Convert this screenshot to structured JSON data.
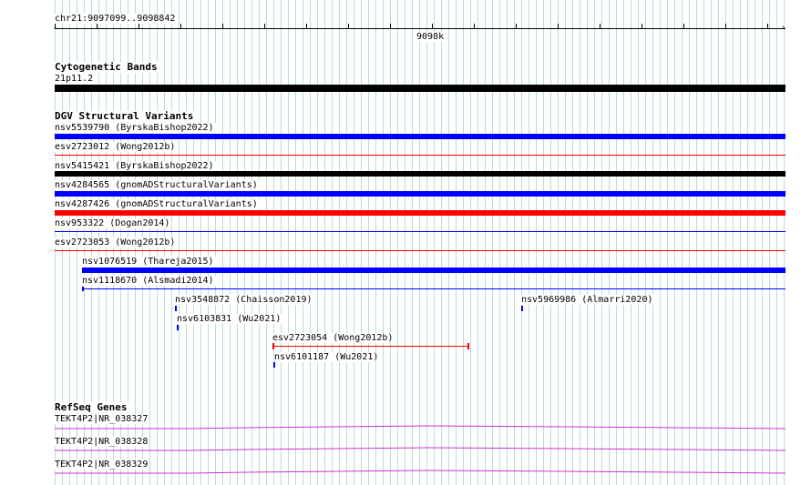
{
  "ruler": {
    "position_label": "chr21:9097099..9098842",
    "tick_label": "9098k"
  },
  "cytobands": {
    "title": "Cytogenetic Bands",
    "band_label": "21p11.2"
  },
  "dgv": {
    "title": "DGV Structural Variants",
    "items": [
      {
        "label": "nsv5539790 (ByrskaBishop2022)",
        "color": "#0000ff"
      },
      {
        "label": "esv2723012 (Wong2012b)",
        "color": "#ff0000"
      },
      {
        "label": "nsv5415421 (ByrskaBishop2022)",
        "color": "#000000"
      },
      {
        "label": "nsv4284565 (gnomADStructuralVariants)",
        "color": "#0000ff"
      },
      {
        "label": "nsv4287426 (gnomADStructuralVariants)",
        "color": "#ff0000"
      },
      {
        "label": "nsv953322 (Dogan2014)",
        "color": "#0000ff"
      },
      {
        "label": "esv2723053 (Wong2012b)",
        "color": "#ff0000"
      },
      {
        "label": "nsv1076519 (Thareja2015)",
        "color": "#0000ff"
      },
      {
        "label": "nsv1118670 (Alsmadi2014)",
        "color": "#0000ff"
      },
      {
        "label": "nsv3548872 (Chaisson2019)",
        "color": "#0000ff"
      },
      {
        "label": "nsv5969986 (Almarri2020)",
        "color": "#0000ff"
      },
      {
        "label": "nsv6103831 (Wu2021)",
        "color": "#0000ff"
      },
      {
        "label": "esv2723054 (Wong2012b)",
        "color": "#ff0000"
      },
      {
        "label": "nsv6101187 (Wu2021)",
        "color": "#0000ff"
      }
    ]
  },
  "refseq": {
    "title": "RefSeq Genes",
    "items": [
      {
        "label": "TEKT4P2|NR_038327",
        "color": "#cc33cc"
      },
      {
        "label": "TEKT4P2|NR_038328",
        "color": "#cc33cc"
      },
      {
        "label": "TEKT4P2|NR_038329",
        "color": "#cc33cc"
      }
    ]
  }
}
